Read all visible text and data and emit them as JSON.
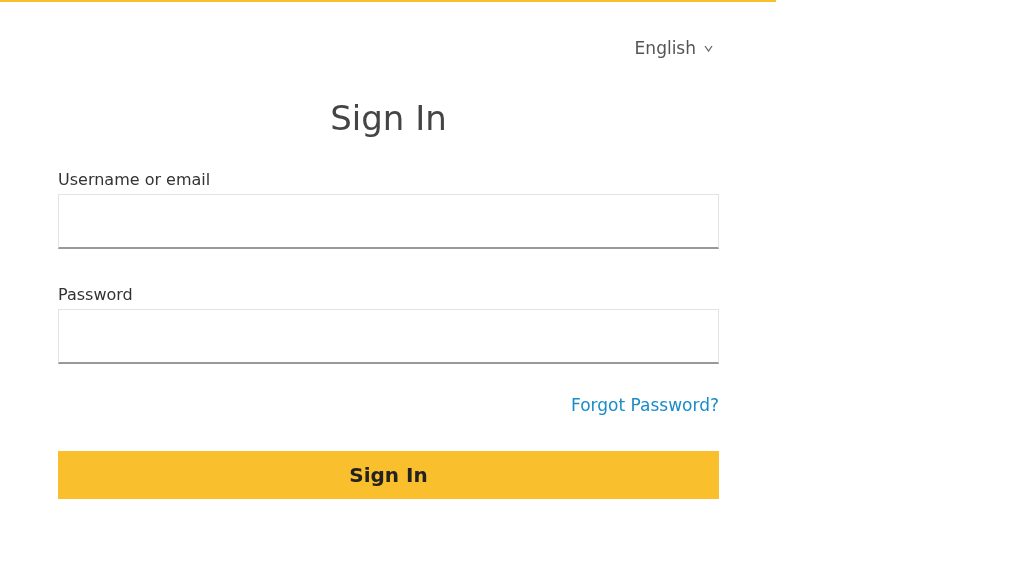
{
  "language": {
    "label": "English"
  },
  "title": "Sign In",
  "fields": [
    {
      "label": "Username or email"
    },
    {
      "label": "Password"
    }
  ],
  "forgot_link": "Forgot Password?",
  "submit_button": "Sign In"
}
